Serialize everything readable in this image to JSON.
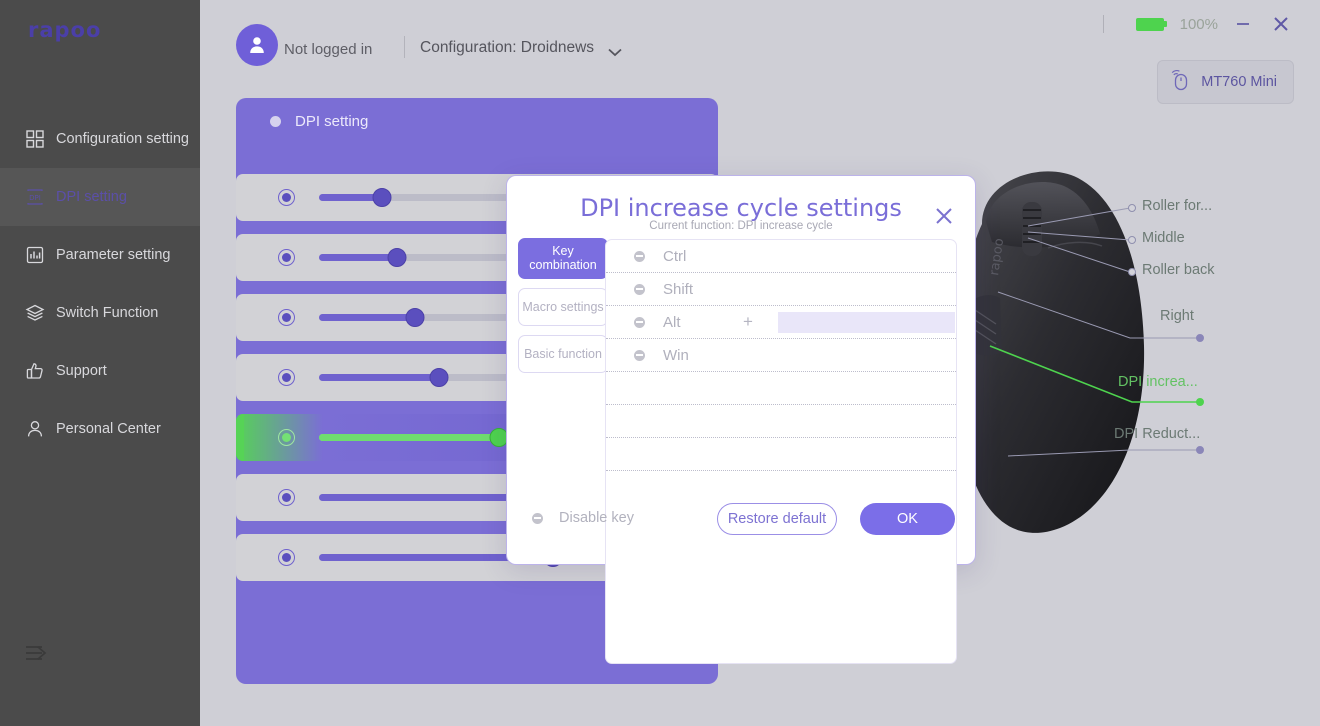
{
  "app": {
    "brand": "rapoo"
  },
  "sidebar": {
    "items": [
      {
        "label": "Configuration setting",
        "icon": "grid-icon",
        "active": false
      },
      {
        "label": "DPI setting",
        "icon": "dpi-icon",
        "active": true
      },
      {
        "label": "Parameter setting",
        "icon": "bars-icon",
        "active": false
      },
      {
        "label": "Switch Function",
        "icon": "layers-icon",
        "active": false
      },
      {
        "label": "Support",
        "icon": "thumbs-up-icon",
        "active": false
      },
      {
        "label": "Personal Center",
        "icon": "user-icon",
        "active": false
      }
    ],
    "collapse_icon": "collapse-menu-icon"
  },
  "topbar": {
    "login_status": "Not logged in",
    "configuration_label": "Configuration: Droidnews",
    "battery_percent": "100%",
    "battery_color": "#4ed34e",
    "minimize_icon": "minimize-icon",
    "close_icon": "close-icon",
    "device_name": "MT760 Mini",
    "device_icon": "mouse-wireless-icon"
  },
  "dpi_panel": {
    "title": "DPI setting",
    "rows": [
      {
        "selected": true,
        "active": false,
        "value": 21
      },
      {
        "selected": true,
        "active": false,
        "value": 26
      },
      {
        "selected": true,
        "active": false,
        "value": 32
      },
      {
        "selected": true,
        "active": false,
        "value": 40
      },
      {
        "selected": true,
        "active": true,
        "value": 60
      },
      {
        "selected": true,
        "active": false,
        "value": 72
      },
      {
        "selected": true,
        "active": false,
        "value": 78
      }
    ]
  },
  "mouse_callouts": [
    {
      "label": "Roller for...",
      "kind": "hollow",
      "green": false
    },
    {
      "label": "Middle",
      "kind": "hollow",
      "green": false
    },
    {
      "label": "Roller back",
      "kind": "hollow",
      "green": false
    },
    {
      "label": "Right",
      "kind": "filled",
      "green": false
    },
    {
      "label": "DPI increa...",
      "kind": "filled",
      "green": true
    },
    {
      "label": "DPI Reduct...",
      "kind": "filled",
      "green": false
    }
  ],
  "modal": {
    "title": "DPI increase cycle settings",
    "subtitle": "Current function: DPI increase cycle",
    "close_icon": "close-icon",
    "tabs": [
      {
        "label": "Key combination",
        "active": true
      },
      {
        "label": "Macro settings",
        "active": false
      },
      {
        "label": "Basic function",
        "active": false
      }
    ],
    "keys": [
      {
        "label": "Ctrl",
        "has_plus": false,
        "has_input": false
      },
      {
        "label": "Shift",
        "has_plus": false,
        "has_input": false
      },
      {
        "label": "Alt",
        "has_plus": true,
        "has_input": true,
        "input_value": "",
        "input_placeholder": ""
      },
      {
        "label": "Win",
        "has_plus": false,
        "has_input": false
      },
      {
        "label": "",
        "has_plus": false,
        "has_input": false
      },
      {
        "label": "",
        "has_plus": false,
        "has_input": false
      },
      {
        "label": "",
        "has_plus": false,
        "has_input": false
      },
      {
        "label": "",
        "has_plus": false,
        "has_input": false
      }
    ],
    "disable_key_label": "Disable key",
    "restore_label": "Restore default",
    "ok_label": "OK"
  },
  "colors": {
    "accent": "#7b6ed5",
    "accent_strong": "#7b6ee8",
    "panel_bg": "#cfcfd6",
    "sidebar_bg": "#4b4b4b",
    "green": "#4ed34e"
  }
}
